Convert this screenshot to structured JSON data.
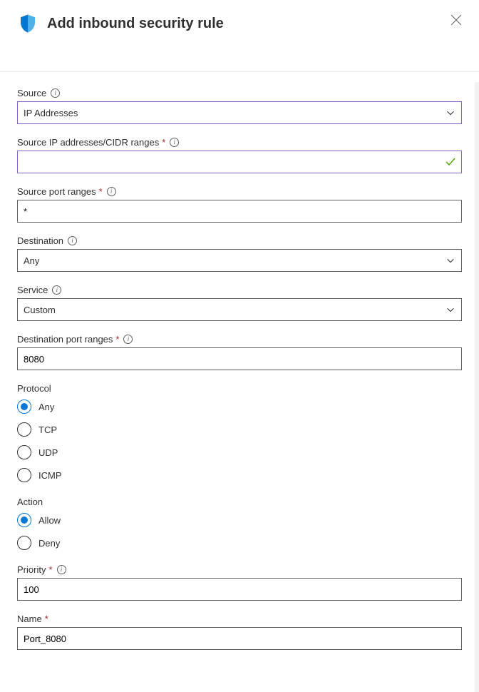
{
  "title": "Add inbound security rule",
  "fields": {
    "source": {
      "label": "Source",
      "value": "IP Addresses"
    },
    "sourceIp": {
      "label": "Source IP addresses/CIDR ranges",
      "value": ""
    },
    "sourcePort": {
      "label": "Source port ranges",
      "value": "*"
    },
    "destination": {
      "label": "Destination",
      "value": "Any"
    },
    "service": {
      "label": "Service",
      "value": "Custom"
    },
    "destPort": {
      "label": "Destination port ranges",
      "value": "8080"
    },
    "protocol": {
      "label": "Protocol",
      "options": {
        "any": "Any",
        "tcp": "TCP",
        "udp": "UDP",
        "icmp": "ICMP"
      }
    },
    "action": {
      "label": "Action",
      "options": {
        "allow": "Allow",
        "deny": "Deny"
      }
    },
    "priority": {
      "label": "Priority",
      "value": "100"
    },
    "name": {
      "label": "Name",
      "value": "Port_8080"
    }
  }
}
